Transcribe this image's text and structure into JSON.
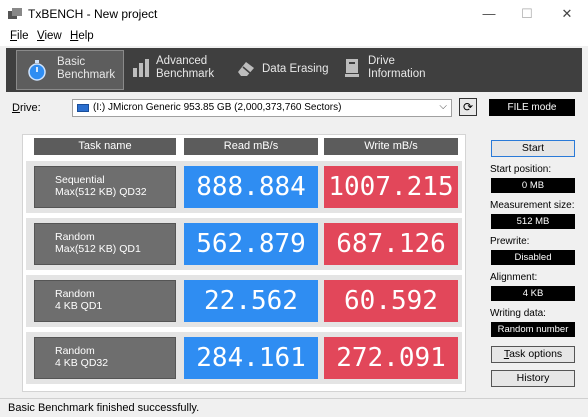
{
  "window": {
    "title": "TxBENCH - New project",
    "minimize": "—",
    "maximize": "☐",
    "close": "✕"
  },
  "menu": [
    {
      "key": "F",
      "rest": "ile"
    },
    {
      "key": "V",
      "rest": "iew"
    },
    {
      "key": "H",
      "rest": "elp"
    }
  ],
  "tabs": [
    {
      "line1": "Basic",
      "line2": "Benchmark",
      "icon": "stopwatch-icon",
      "active": true
    },
    {
      "line1": "Advanced",
      "line2": "Benchmark",
      "icon": "bar-chart-icon",
      "active": false
    },
    {
      "line1": "Data Erasing",
      "line2": "",
      "icon": "eraser-icon",
      "active": false
    },
    {
      "line1": "Drive",
      "line2": "Information",
      "icon": "drive-info-icon",
      "active": false
    }
  ],
  "drive": {
    "label_key": "D",
    "label_rest": "rive:",
    "selected": "(I:) JMicron Generic  953.85 GB (2,000,373,760 Sectors)",
    "mode": "FILE mode"
  },
  "table": {
    "headers": {
      "task": "Task name",
      "read": "Read mB/s",
      "write": "Write mB/s"
    },
    "rows": [
      {
        "line1": "Sequential",
        "line2": "Max(512 KB) QD32",
        "read": "888.884",
        "write": "1007.215"
      },
      {
        "line1": "Random",
        "line2": "Max(512 KB) QD1",
        "read": "562.879",
        "write": "687.126"
      },
      {
        "line1": "Random",
        "line2": "4 KB QD1",
        "read": "22.562",
        "write": "60.592"
      },
      {
        "line1": "Random",
        "line2": "4 KB QD32",
        "read": "284.161",
        "write": "272.091"
      }
    ]
  },
  "side": {
    "start_label": "Start",
    "start_position_label": "Start position:",
    "start_position": "0 MB",
    "measurement_size_label": "Measurement size:",
    "measurement_size": "512 MB",
    "prewrite_label": "Prewrite:",
    "prewrite": "Disabled",
    "alignment_label": "Alignment:",
    "alignment": "4 KB",
    "writing_data_label": "Writing data:",
    "writing_data": "Random number",
    "task_options_key": "T",
    "task_options_rest": "ask options",
    "history_label": "History"
  },
  "status": "Basic Benchmark finished successfully.",
  "colors": {
    "read": "#2f8df2",
    "write": "#e2475a",
    "toolbar": "#3f3f3f",
    "header": "#5c5c5c"
  }
}
